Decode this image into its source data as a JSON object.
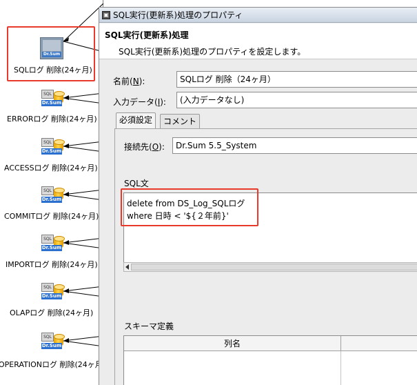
{
  "flow_nodes": [
    {
      "label": "SQLログ 削除(24ヶ月)",
      "icon_text": "SQL",
      "tag": "Dr.Sum",
      "selected": true
    },
    {
      "label": "ERRORログ 削除(24ヶ月)",
      "icon_text": "SQL",
      "tag": "Dr.Sum"
    },
    {
      "label": "ACCESSログ 削除(24ヶ月)",
      "icon_text": "SQL",
      "tag": "Dr.Sum"
    },
    {
      "label": "COMMITログ 削除(24ヶ月)",
      "icon_text": "SQL",
      "tag": "Dr.Sum"
    },
    {
      "label": "IMPORTログ 削除(24ヶ月)",
      "icon_text": "SQL",
      "tag": "Dr.Sum"
    },
    {
      "label": "OLAPログ 削除(24ヶ月)",
      "icon_text": "SQL",
      "tag": "Dr.Sum"
    },
    {
      "label": "OPERATIONログ 削除(24ヶ月",
      "icon_text": "SQL",
      "tag": "Dr.Sum"
    }
  ],
  "dialog": {
    "title": "SQL実行(更新系)処理のプロパティ",
    "header_title": "SQL実行(更新系)処理",
    "header_desc": "SQL実行(更新系)処理のプロパティを設定します。",
    "name_label": "名前(",
    "name_key": "N",
    "name_label_end": "):",
    "name_value": "SQLログ 削除（24ヶ月）",
    "input_label": "入力データ(",
    "input_key": "I",
    "input_label_end": "):",
    "input_value": "(入力データなし)",
    "tabs": [
      "必須設定",
      "コメント"
    ],
    "conn_label": "接続先(",
    "conn_key": "O",
    "conn_label_end": "):",
    "conn_value": "Dr.Sum 5.5_System",
    "sql_label": "SQL文",
    "sql_lines": [
      "delete from DS_Log_SQLログ",
      "where 日時 < '${２年前}'"
    ],
    "schema_label": "スキーマ定義",
    "schema_col_name": "列名"
  },
  "colors": {
    "highlight": "#e8392b",
    "title_bar": "#c9d4e2",
    "dialog_bg": "#ececec"
  }
}
